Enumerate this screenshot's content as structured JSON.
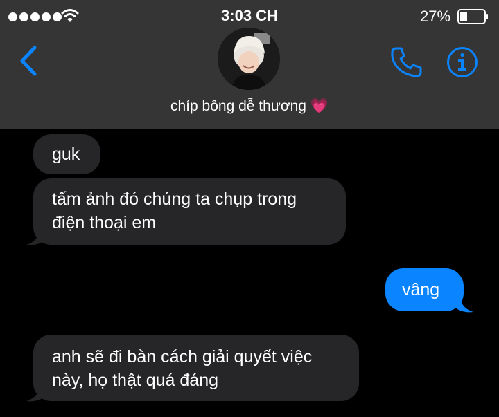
{
  "status_bar": {
    "time": "3:03 CH",
    "battery_percent": "27%",
    "signal_icon": "signal-dots-icon",
    "wifi_icon": "wifi-icon",
    "battery_icon": "battery-icon"
  },
  "header": {
    "contact_name": "chíp bông dễ thương",
    "name_emoji": "💗",
    "back_icon": "chevron-left-icon",
    "call_icon": "phone-icon",
    "info_icon": "info-icon"
  },
  "messages": [
    {
      "direction": "received",
      "text": "guk"
    },
    {
      "direction": "received",
      "lines": [
        "tấm ảnh đó chúng ta chụp trong",
        "điện thoại em"
      ]
    },
    {
      "direction": "sent",
      "text": "vâng"
    },
    {
      "direction": "received",
      "lines": [
        "anh sẽ đi bàn cách giải quyết việc",
        "này, họ thật quá đáng"
      ]
    }
  ],
  "colors": {
    "header_bg": "#353535",
    "accent_blue": "#0a84ff",
    "received_bubble": "#262628",
    "background": "#000000"
  }
}
